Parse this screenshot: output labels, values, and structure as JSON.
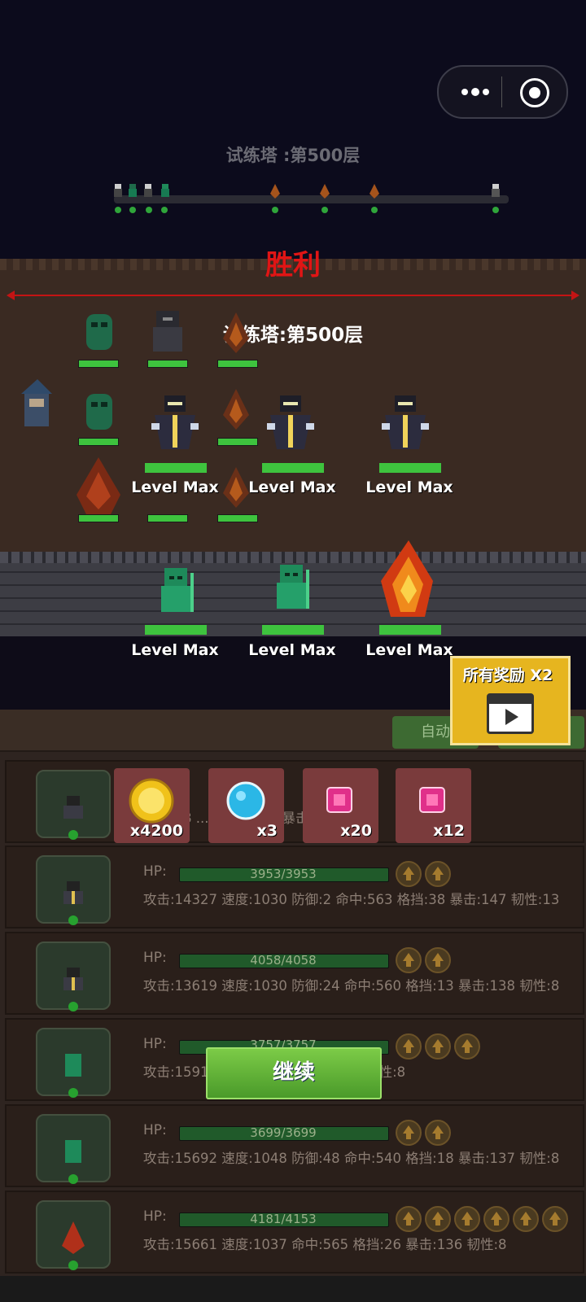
{
  "top": {
    "title": "试练塔 :第500层"
  },
  "battle": {
    "result": "胜利",
    "title": "试练塔:第500层",
    "units": [
      {
        "label": "Level Max"
      },
      {
        "label": "Level Max"
      },
      {
        "label": "Level Max"
      },
      {
        "label": "Level Max"
      },
      {
        "label": "Level Max"
      },
      {
        "label": "Level Max"
      }
    ]
  },
  "controls": {
    "auto_label": "自动",
    "double_reward_label": "所有奖励 X2"
  },
  "rewards": [
    {
      "icon": "gold-coin-icon",
      "count": "x4200"
    },
    {
      "icon": "blue-orb-icon",
      "count": "x3"
    },
    {
      "icon": "pink-gem-icon",
      "count": "x20"
    },
    {
      "icon": "pink-gem-icon",
      "count": "x12"
    }
  ],
  "heroes": [
    {
      "hp_label": "HP:",
      "hp": "",
      "stats": "攻击:18 ... 防 ...56 ... 暴击:132 韧性:"
    },
    {
      "hp_label": "HP:",
      "hp": "3953/3953",
      "stats": "攻击:14327 速度:1030 防御:2 命中:563 格挡:38 暴击:147 韧性:13"
    },
    {
      "hp_label": "HP:",
      "hp": "4058/4058",
      "stats": "攻击:13619 速度:1030 防御:24 命中:560 格挡:13 暴击:138 韧性:8"
    },
    {
      "hp_label": "HP:",
      "hp": "3757/3757",
      "stats": "攻击:1591 ... 545 格挡:8 暴击:137 韧性:8"
    },
    {
      "hp_label": "HP:",
      "hp": "3699/3699",
      "stats": "攻击:15692 速度:1048 防御:48 命中:540 格挡:18 暴击:137 韧性:8"
    },
    {
      "hp_label": "HP:",
      "hp": "4181/4153",
      "stats": "攻击:15661 速度:1037 命中:565 格挡:26 暴击:136 韧性:8"
    }
  ],
  "continue_label": "继续"
}
